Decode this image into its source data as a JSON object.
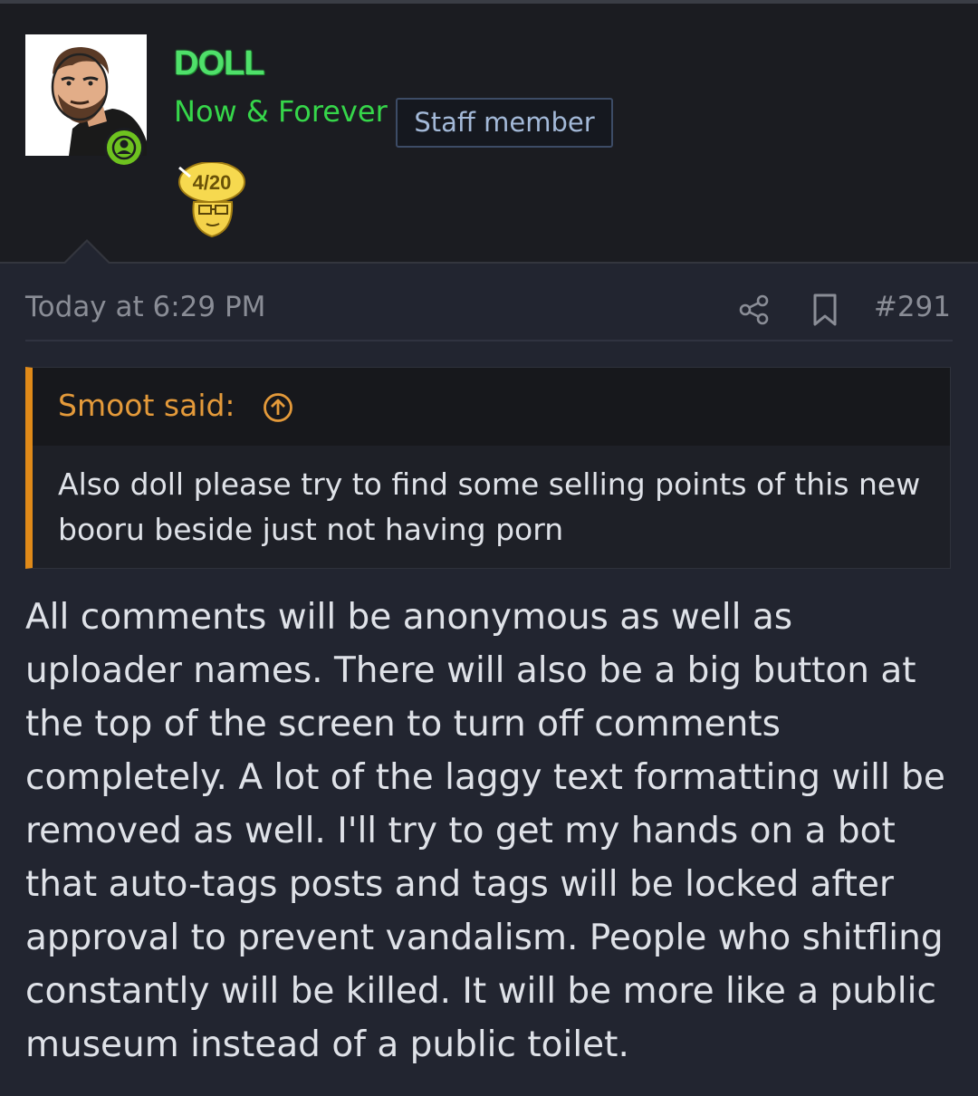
{
  "user": {
    "name": "DOLL",
    "title": "Now & Forever",
    "badge": "Staff member",
    "trophy_text": "4/20"
  },
  "post": {
    "time": "Today at 6:29 PM",
    "number": "#291",
    "body": "All comments will be anonymous as well as uploader names. There will also be a big button at the top of the screen to turn off comments completely. A lot of the laggy text formatting will be removed as well. I'll try to get my hands on a bot that auto-tags posts and tags will be locked after approval to prevent vandalism. People who shitfling constantly will be killed. It will be more like a public museum instead of a public toilet."
  },
  "quote": {
    "author": "Smoot said:",
    "body": "Also doll please try to find some selling points of this new booru beside just not having porn"
  },
  "icons": {
    "share": "share-icon",
    "bookmark": "bookmark-icon",
    "quote_jump": "arrow-up-circle-icon",
    "online": "user-online-icon"
  },
  "colors": {
    "username": "#4fe06a",
    "title": "#36d64a",
    "quote_accent": "#e08a19",
    "online": "#6ec21f"
  }
}
